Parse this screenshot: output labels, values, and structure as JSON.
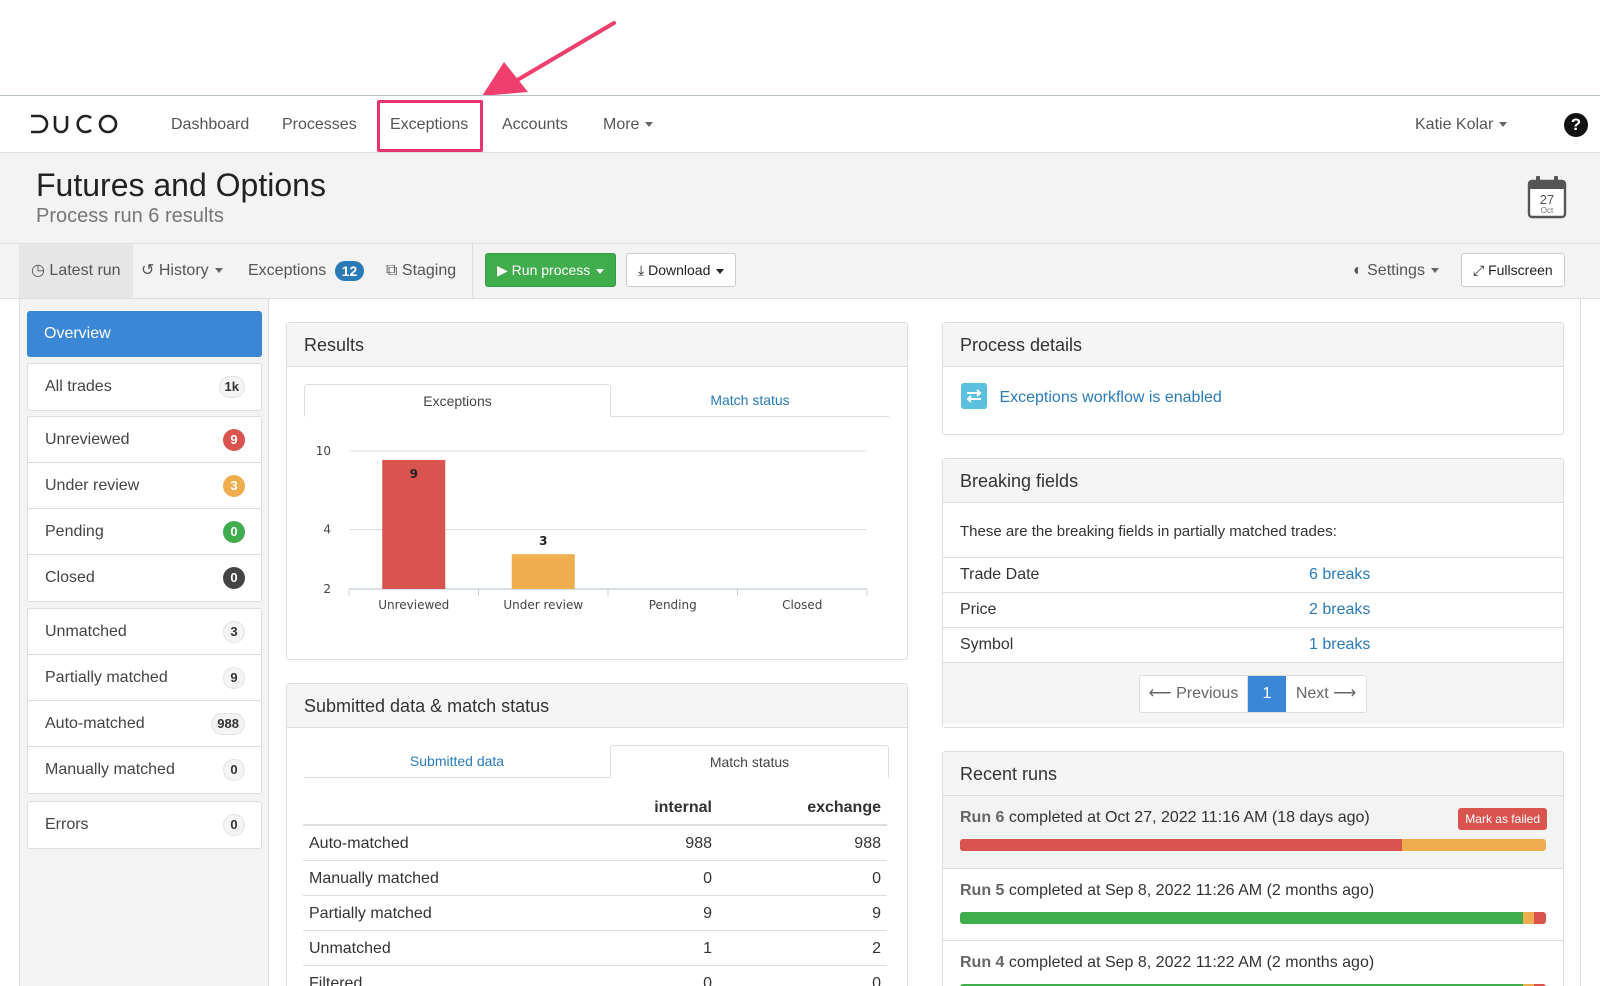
{
  "nav": {
    "brand": "DUCO",
    "items": [
      "Dashboard",
      "Processes",
      "Exceptions",
      "Accounts",
      "More"
    ],
    "user": "Katie Kolar",
    "help": "?"
  },
  "header": {
    "title": "Futures and Options",
    "subtitle": "Process run 6 results",
    "calendar_day": "27",
    "calendar_month": "Oct"
  },
  "toolbar": {
    "latest_run": "Latest run",
    "history": "History",
    "exceptions": "Exceptions",
    "exceptions_count": "12",
    "staging": "Staging",
    "run_process": "Run process",
    "download": "Download",
    "settings": "Settings",
    "fullscreen": "Fullscreen"
  },
  "sidebar": {
    "overview": "Overview",
    "all_trades": {
      "label": "All trades",
      "count": "1k"
    },
    "status": [
      {
        "label": "Unreviewed",
        "count": "9",
        "color": "#d9534f"
      },
      {
        "label": "Under review",
        "count": "3",
        "color": "#f0ad4e"
      },
      {
        "label": "Pending",
        "count": "0",
        "color": "#3fad4b"
      },
      {
        "label": "Closed",
        "count": "0",
        "color": "#444444"
      }
    ],
    "match": [
      {
        "label": "Unmatched",
        "count": "3"
      },
      {
        "label": "Partially matched",
        "count": "9"
      },
      {
        "label": "Auto-matched",
        "count": "988"
      },
      {
        "label": "Manually matched",
        "count": "0"
      }
    ],
    "errors": {
      "label": "Errors",
      "count": "0"
    }
  },
  "results": {
    "title": "Results",
    "tabs": [
      "Exceptions",
      "Match status"
    ]
  },
  "chart_data": {
    "type": "bar",
    "categories": [
      "Unreviewed",
      "Under review",
      "Pending",
      "Closed"
    ],
    "values": [
      9,
      3,
      0,
      0
    ],
    "colors": [
      "#d9534f",
      "#f0ad4e",
      "#3fad4b",
      "#444444"
    ],
    "y_ticks": [
      2,
      4,
      10
    ],
    "y_scale": "log",
    "ylim": [
      2,
      10
    ],
    "grid": true
  },
  "submitted": {
    "title": "Submitted data & match status",
    "tabs": [
      "Submitted data",
      "Match status"
    ],
    "columns": [
      "",
      "internal",
      "exchange"
    ],
    "rows": [
      [
        "Auto-matched",
        "988",
        "988"
      ],
      [
        "Manually matched",
        "0",
        "0"
      ],
      [
        "Partially matched",
        "9",
        "9"
      ],
      [
        "Unmatched",
        "1",
        "2"
      ],
      [
        "Filtered",
        "0",
        "0"
      ]
    ]
  },
  "process_details": {
    "title": "Process details",
    "workflow": "Exceptions workflow is enabled"
  },
  "breaking_fields": {
    "title": "Breaking fields",
    "description": "These are the breaking fields in partially matched trades:",
    "rows": [
      {
        "field": "Trade Date",
        "breaks": "6 breaks"
      },
      {
        "field": "Price",
        "breaks": "2 breaks"
      },
      {
        "field": "Symbol",
        "breaks": "1 breaks"
      }
    ],
    "pager": {
      "previous": "Previous",
      "page": "1",
      "next": "Next"
    }
  },
  "recent_runs": {
    "title": "Recent runs",
    "mark_failed": "Mark as failed",
    "runs": [
      {
        "run": "Run 6",
        "text": "completed at Oct 27, 2022 11:16 AM (18 days ago)",
        "progress": [
          {
            "color": "#d9534f",
            "frac": 0.755
          },
          {
            "color": "#f0ad4e",
            "frac": 0.245
          }
        ]
      },
      {
        "run": "Run 5",
        "text": "completed at Sep 8, 2022 11:26 AM (2 months ago)",
        "progress": [
          {
            "color": "#3fad4b",
            "frac": 0.96
          },
          {
            "color": "#f0ad4e",
            "frac": 0.02
          },
          {
            "color": "#d9534f",
            "frac": 0.02
          }
        ]
      },
      {
        "run": "Run 4",
        "text": "completed at Sep 8, 2022 11:22 AM (2 months ago)",
        "progress": [
          {
            "color": "#3fad4b",
            "frac": 0.96
          },
          {
            "color": "#f0ad4e",
            "frac": 0.02
          },
          {
            "color": "#d9534f",
            "frac": 0.02
          }
        ]
      }
    ]
  }
}
